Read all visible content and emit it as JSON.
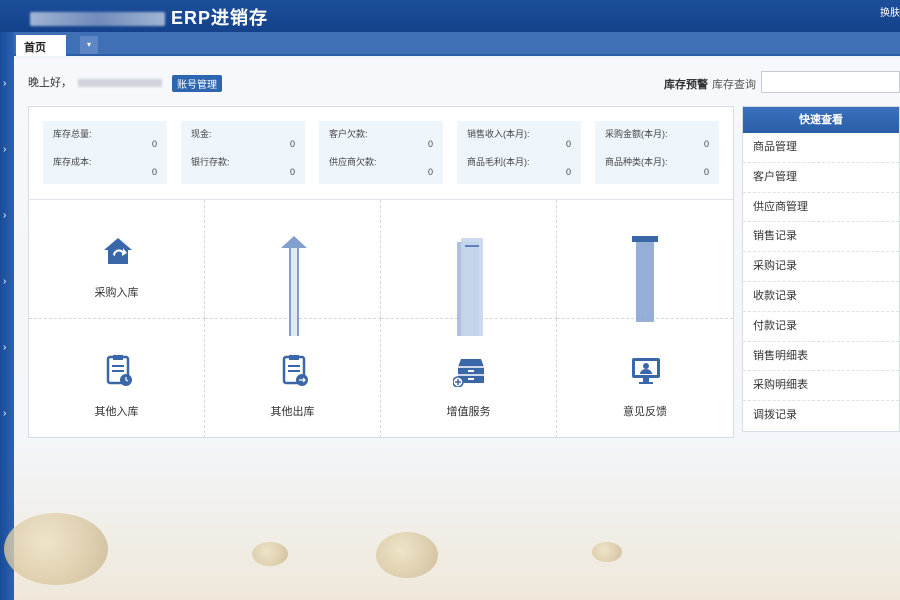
{
  "header": {
    "title_suffix": "ERP进销存",
    "right_link": "换肤"
  },
  "tabs": {
    "home": "首页",
    "dropdown_glyph": "▾"
  },
  "greeting": {
    "text": "晚上好，",
    "account_button": "账号管理"
  },
  "inventory": {
    "warning": "库存预警",
    "query": "库存查询",
    "query_input_value": ""
  },
  "stats": [
    {
      "l1": "库存总量:",
      "v1": "0",
      "l2": "库存成本:",
      "v2": "0"
    },
    {
      "l1": "现金:",
      "v1": "0",
      "l2": "银行存款:",
      "v2": "0"
    },
    {
      "l1": "客户欠款:",
      "v1": "0",
      "l2": "供应商欠款:",
      "v2": "0"
    },
    {
      "l1": "销售收入(本月):",
      "v1": "0",
      "l2": "商品毛利(本月):",
      "v2": "0"
    },
    {
      "l1": "采购金额(本月):",
      "v1": "0",
      "l2": "商品种类(本月):",
      "v2": "0"
    }
  ],
  "tiles": [
    {
      "label": "采购入库",
      "icon": "house-arrow-icon"
    },
    {
      "label": "",
      "icon": "upload-icon"
    },
    {
      "label": "",
      "icon": "document-icon"
    },
    {
      "label": "",
      "icon": "tag-icon"
    },
    {
      "label": "其他入库",
      "icon": "clipboard-clock-icon"
    },
    {
      "label": "其他出库",
      "icon": "clipboard-arrow-icon"
    },
    {
      "label": "增值服务",
      "icon": "drawer-plus-icon"
    },
    {
      "label": "意见反馈",
      "icon": "monitor-user-icon"
    }
  ],
  "quick_view": {
    "title": "快速查看",
    "items": [
      "商品管理",
      "客户管理",
      "供应商管理",
      "销售记录",
      "采购记录",
      "收款记录",
      "付款记录",
      "销售明细表",
      "采购明细表",
      "调拨记录"
    ]
  },
  "colors": {
    "primary": "#2d65b0",
    "header": "#1d4f9c",
    "stat_bg": "#eef5fb",
    "icon": "#3a67a8"
  }
}
